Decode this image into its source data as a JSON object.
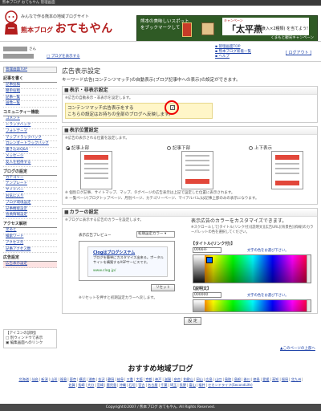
{
  "topbar": {
    "text": "熊本ブログ おてもやん 管理画面"
  },
  "header": {
    "tagline": "みんなで作る熊本の地域ブログサイト",
    "brand_small": "熊本ブログ",
    "brand_big": "おてもやん"
  },
  "banner": {
    "line1": "熊本の美味しいスポット",
    "line2": "をブックマークして",
    "highlight_small": "キャンペーン",
    "highlight_big": "「太平燕",
    "highlight_sub": "(5食入×2種類) を当てよう!",
    "footer": "くまもと観光キャンペーン"
  },
  "userbar": {
    "user_suffix": "さん",
    "blog_link": "ブログを表示する",
    "links": [
      "管理画面TOP",
      "熊本ブログ新着一覧",
      "ヘルプ"
    ],
    "logout": "[ ログアウト ]"
  },
  "sidebar": {
    "top": "管理画面TOP",
    "sections": [
      {
        "head": "記事を書く",
        "items": [
          "記事投稿",
          "簡単投稿",
          "記事一覧",
          "画像一覧"
        ]
      },
      {
        "head": "コミュニティー機能",
        "items": [
          "コメント",
          "トラックバック",
          "フォトテーマ",
          "マップトラックバック",
          "カレンダートラックバック",
          "書き込みQ&A",
          "メッセージ",
          "友人を招待する"
        ]
      },
      {
        "head": "ブログの設定",
        "items": [
          "カテゴリー",
          "テンプレート",
          "サイドバー",
          "お気に入り",
          "ブログ環境設定",
          "記事機能設定",
          "会員情報設定"
        ]
      },
      {
        "head": "アクセス解析",
        "items": [
          "足あと",
          "検索ワード",
          "アクセス元",
          "記事アクセス数"
        ]
      },
      {
        "head": "広告設定",
        "items": [
          "広告表示設定"
        ]
      }
    ]
  },
  "main": {
    "title": "広告表示設定",
    "subtitle": "キーワード広告(コンテンツマッチ)の自動表示(ブログ記事中への表示)の設定ができます。",
    "display_box": {
      "title": "表示・非表示設定",
      "note": "※広告の自動表示・非表示を設定します。",
      "cm_line1": "コンテンツマッチ広告表示をする",
      "cm_check": "✓",
      "cm_line2": "こちらの設定はお持ちの全部のブログへ反映します。"
    },
    "position_box": {
      "title": "表示位置設定",
      "note": "※広告の表示される位置を設定します。",
      "options": [
        "記事上部",
        "記事下部",
        "上下表示"
      ],
      "selected": 0,
      "note2": "※ 個別ログ記事、サイトマップ、マップ、タグページの広告表示は上記で設定した位置に表示されます。",
      "note3": "※ 一覧ページ(ブログトップページ、月別ページ、カテゴリーページ、マイアルバム)は記事上部のみの表示になります。"
    },
    "color_box": {
      "title": "カラーの設定",
      "note": "※ブログに表示する広告のカラーを設定します。",
      "preview_label": "表示広告プレビュー",
      "preview_select": "初期設定カラー",
      "preview_ad_title": "Clogはブログシステム",
      "preview_ad_desc": "ブログを簡単にカスタマイズ出来る。ポータルサイトを構築するASPサービスです。",
      "preview_ad_url": "www.clog.jp/",
      "reset_label": "リセット",
      "reset_note": "※リセットを押すと初期設定カラーへ戻します。",
      "custom_title": "表示広告のカラーをカスタマイズできます。",
      "custom_note": "※スクロールして[タイトル(リンク付)][説明文][広告URL][背景色][枠線]のカラーパレットの色を選択してください。",
      "fields": [
        {
          "label": "タイトル(リンク付)",
          "value": "0066FF",
          "hint": "文字の色をお選び下さい。",
          "swatch": "#0066ff"
        },
        {
          "label": "説明文",
          "value": "000000",
          "hint": "文字の色をお選び下さい。",
          "swatch": "#000000"
        }
      ]
    },
    "submit": "設 定",
    "to_top": "このページの上部へ"
  },
  "icon_legend": {
    "head": "アイコンの説明",
    "items": [
      "別ウィンドウで表示",
      "編集画面へのリンク"
    ]
  },
  "recommend": {
    "title": "おすすめ地域ブログ",
    "links": [
      "北海道",
      "仙台",
      "新潟",
      "山形",
      "福島",
      "東京",
      "横浜",
      "湘南",
      "金沢",
      "静岡",
      "岐阜",
      "三重",
      "大阪",
      "京都",
      "神戸",
      "滋賀",
      "奈良",
      "和歌山",
      "岡山",
      "広島",
      "山口",
      "鳥取",
      "島根",
      "香川",
      "徳島",
      "愛媛",
      "高知",
      "福岡",
      "北九州",
      "佐賀",
      "長崎",
      "大分",
      "宮崎",
      "鹿児島",
      "沖縄",
      "石垣",
      "宮古",
      "名古屋",
      "千葉",
      "埼玉",
      "長野",
      "富山",
      "福井",
      "セカンドライフ(SecondLife)"
    ]
  },
  "footer": {
    "text": "Copyright©2007 / 熊本ブログ おてもやん. All Rights Reserved."
  },
  "colors": {
    "brand": "#b31d1d",
    "banner_bg": "#2f5a25",
    "link": "#1a3fa6",
    "note_bg": "#fff6c8",
    "highlight_ring": "#e00000"
  }
}
